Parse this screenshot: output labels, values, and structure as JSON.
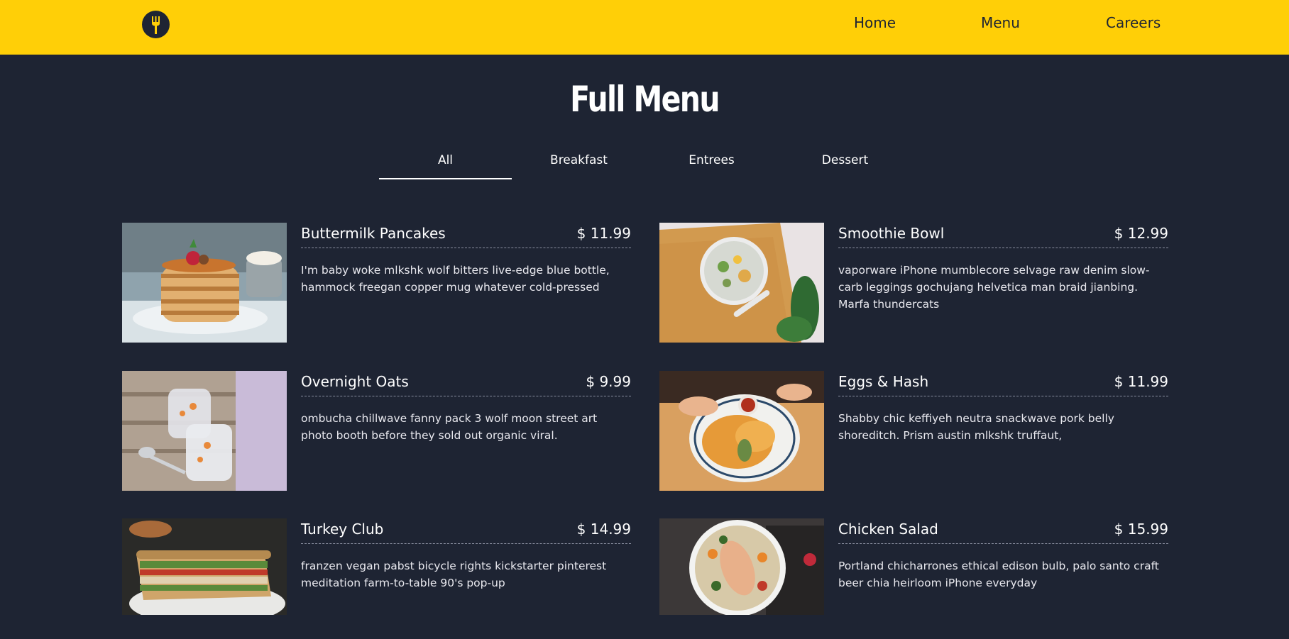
{
  "header": {
    "logo_icon": "fork-icon",
    "nav": [
      {
        "label": "Home"
      },
      {
        "label": "Menu"
      },
      {
        "label": "Careers"
      }
    ]
  },
  "main": {
    "title": "Full Menu",
    "tabs": [
      {
        "label": "All",
        "active": true
      },
      {
        "label": "Breakfast",
        "active": false
      },
      {
        "label": "Entrees",
        "active": false
      },
      {
        "label": "Dessert",
        "active": false
      }
    ],
    "items": [
      {
        "name": "Buttermilk Pancakes",
        "price": "$ 11.99",
        "desc": "I'm baby woke mlkshk wolf bitters live-edge blue bottle, hammock freegan copper mug whatever cold-pressed",
        "image": "pancakes-photo"
      },
      {
        "name": "Smoothie Bowl",
        "price": "$ 12.99",
        "desc": "vaporware iPhone mumblecore selvage raw denim slow-carb leggings gochujang helvetica man braid jianbing. Marfa thundercats",
        "image": "smoothie-bowl-photo"
      },
      {
        "name": "Overnight Oats",
        "price": "$ 9.99",
        "desc": "ombucha chillwave fanny pack 3 wolf moon street art photo booth before they sold out organic viral.",
        "image": "overnight-oats-photo"
      },
      {
        "name": "Eggs & Hash",
        "price": "$ 11.99",
        "desc": "Shabby chic keffiyeh neutra snackwave pork belly shoreditch. Prism austin mlkshk truffaut,",
        "image": "eggs-hash-photo"
      },
      {
        "name": "Turkey Club",
        "price": "$ 14.99",
        "desc": "franzen vegan pabst bicycle rights kickstarter pinterest meditation farm-to-table 90's pop-up",
        "image": "turkey-club-photo"
      },
      {
        "name": "Chicken Salad",
        "price": "$ 15.99",
        "desc": "Portland chicharrones ethical edison bulb, palo santo craft beer chia heirloom iPhone everyday",
        "image": "chicken-salad-photo"
      }
    ]
  },
  "colors": {
    "accent": "#ffcf07",
    "background": "#1e2433",
    "text": "#ffffff"
  }
}
